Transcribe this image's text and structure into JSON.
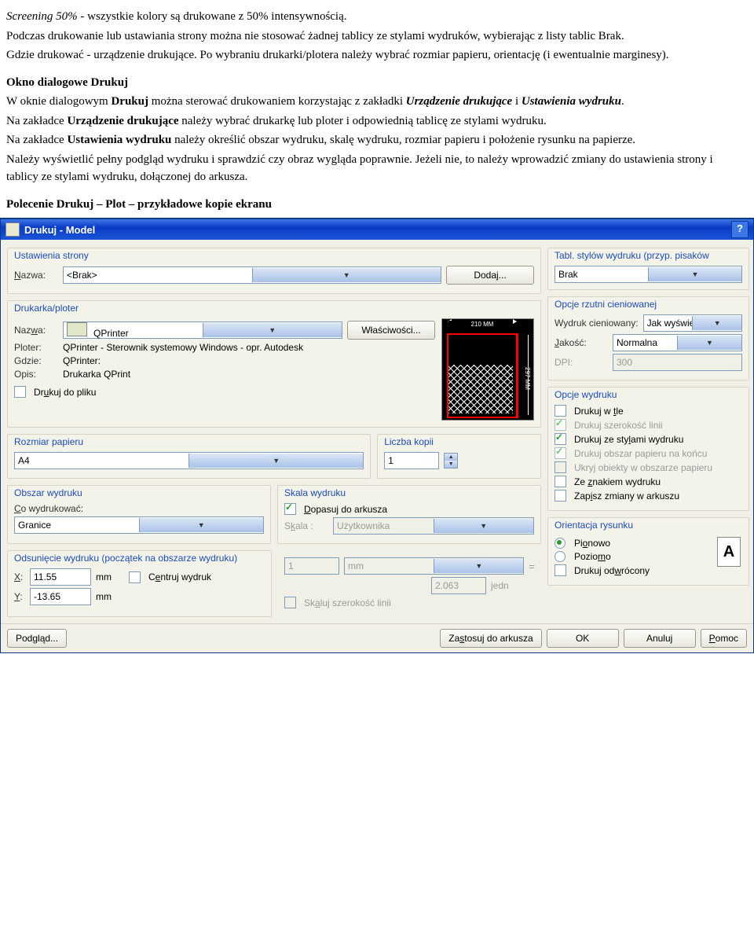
{
  "doc": {
    "p1a": "Screening 50%",
    "p1b": " - wszystkie kolory są drukowane z 50% intensywnością.",
    "p2": "Podczas drukowanie lub ustawiania strony można nie stosować żadnej tablicy ze stylami wydruków, wybierając z listy tablic Brak.",
    "p3": "Gdzie drukować  - urządzenie drukujące. Po wybraniu drukarki/plotera należy wybrać rozmiar papieru, orientację (i ewentualnie marginesy).",
    "h1": "Okno dialogowe Drukuj",
    "p4a": "W oknie dialogowym ",
    "p4b": "Drukuj",
    "p4c": " można sterować drukowaniem korzystając z zakładki ",
    "p4d": "Urządzenie drukujące",
    "p4e": " i ",
    "p4f": "Ustawienia wydruku",
    "p4g": ".",
    "p5a": "Na zakładce ",
    "p5b": "Urządzenie drukujące",
    "p5c": " należy wybrać drukarkę lub ploter i odpowiednią tablicę ze stylami wydruku.",
    "p6a": "Na zakładce ",
    "p6b": "Ustawienia wydruku",
    "p6c": " należy określić obszar wydruku, skalę wydruku, rozmiar papieru i położenie rysunku na papierze.",
    "p7": "Należy wyświetlić pełny podgląd wydruku i sprawdzić czy obraz wygląda poprawnie. Jeżeli nie, to należy wprowadzić zmiany do ustawienia strony i tablicy ze stylami wydruku, dołączonej do arkusza.",
    "h2": "Polecenie Drukuj – Plot – przykładowe kopie ekranu"
  },
  "dlg": {
    "title": "Drukuj - Model",
    "pageSetup": {
      "legend": "Ustawienia strony",
      "nameLbl": "Nazwa:",
      "name": "<Brak>",
      "add": "Dodaj..."
    },
    "printer": {
      "legend": "Drukarka/ploter",
      "nameLbl": "Nazwa:",
      "name": "QPrinter",
      "props": "Właściwości...",
      "ploterLbl": "Ploter:",
      "ploter": "QPrinter - Sterownik systemowy Windows - opr. Autodesk",
      "whereLbl": "Gdzie:",
      "where": "QPrinter:",
      "descLbl": "Opis:",
      "desc": "Drukarka QPrint",
      "toFile": "Drukuj do pliku",
      "paperW": "210 MM",
      "paperH": "297 MM"
    },
    "paper": {
      "legend": "Rozmiar papieru",
      "val": "A4"
    },
    "copies": {
      "legend": "Liczba kopii",
      "val": "1"
    },
    "area": {
      "legend": "Obszar wydruku",
      "lbl": "Co wydrukować:",
      "val": "Granice"
    },
    "scale": {
      "legend": "Skala wydruku",
      "fit": "Dopasuj do arkusza",
      "lbl": "Skala :",
      "val": "Użytkownika",
      "unit1": "1",
      "unit1lbl": "mm",
      "eq": "=",
      "unit2": "2.063",
      "unit2lbl": "jedn",
      "scaleLines": "Skaluj szerokość linii"
    },
    "offset": {
      "legend": "Odsunięcie wydruku (początek na obszarze wydruku)",
      "xlbl": "X:",
      "x": "11.55",
      "ylbl": "Y:",
      "y": "-13.65",
      "mm": "mm",
      "center": "Centruj wydruk"
    },
    "styles": {
      "legend": "Tabl. stylów wydruku (przyp. pisaków",
      "val": "Brak"
    },
    "shade": {
      "legend": "Opcje rzutni cieniowanej",
      "lbl1": "Wydruk cieniowany:",
      "v1": "Jak wyświetlono",
      "lbl2": "Jakość:",
      "v2": "Normalna",
      "lbl3": "DPI:",
      "v3": "300"
    },
    "opts": {
      "legend": "Opcje wydruku",
      "o1": "Drukuj w tle",
      "o2": "Drukuj szerokość linii",
      "o3": "Drukuj ze stylami wydruku",
      "o4": "Drukuj obszar papieru na końcu",
      "o5": "Ukryj obiekty w obszarze papieru",
      "o6": "Ze znakiem wydruku",
      "o7": "Zapisz zmiany w arkuszu"
    },
    "orient": {
      "legend": "Orientacja rysunku",
      "o1": "Pionowo",
      "o2": "Poziomo",
      "o3": "Drukuj odwrócony"
    },
    "footer": {
      "preview": "Podgląd...",
      "apply": "Zastosuj do arkusza",
      "ok": "OK",
      "cancel": "Anuluj",
      "help": "Pomoc"
    }
  }
}
